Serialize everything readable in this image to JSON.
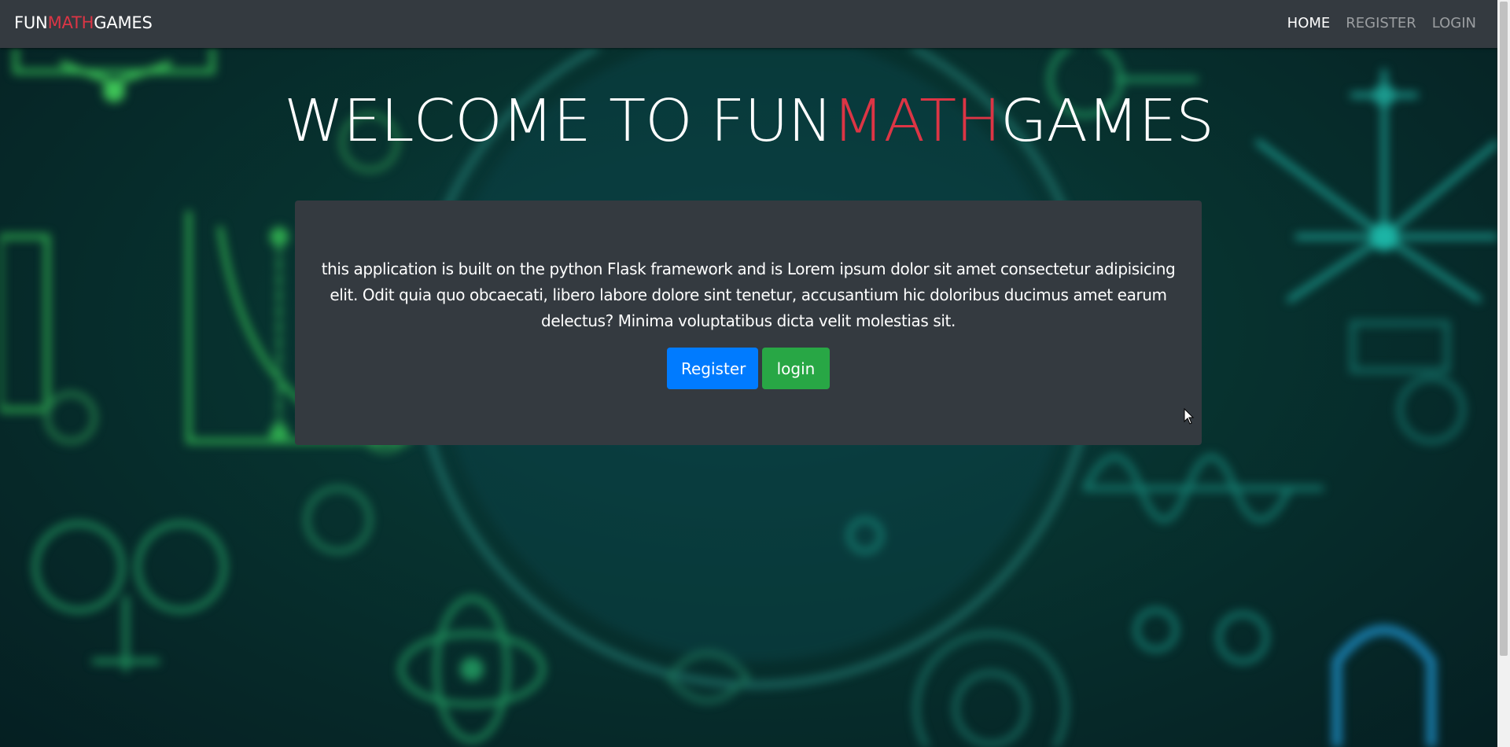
{
  "navbar": {
    "brand": {
      "part1": "FUN",
      "part2": "MATH",
      "part3": "GAMES"
    },
    "links": [
      {
        "label": "HOME",
        "active": true
      },
      {
        "label": "REGISTER",
        "active": false
      },
      {
        "label": "LOGIN",
        "active": false
      }
    ]
  },
  "hero": {
    "title": {
      "part1": "WELCOME TO FUN",
      "part2": "MATH",
      "part3": "GAMES"
    },
    "description": "this application is built on the python Flask framework and is Lorem ipsum dolor sit amet consectetur adipisicing elit. Odit quia quo obcaecati, libero labore dolore sint tenetur, accusantium hic doloribus ducimus amet earum delectus? Minima voluptatibus dicta velit molestias sit.",
    "buttons": {
      "register_label": "Register",
      "login_label": "login"
    }
  },
  "colors": {
    "accent": "#dc3545",
    "navbar": "#343a40",
    "primary": "#007bff",
    "success": "#28a745"
  }
}
